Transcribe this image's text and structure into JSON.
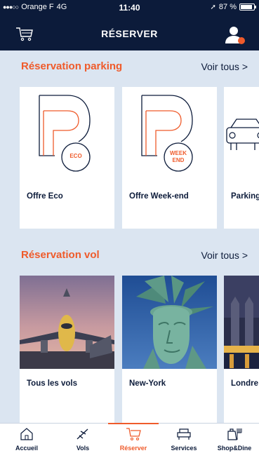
{
  "status_bar": {
    "carrier": "Orange F",
    "network": "4G",
    "time": "11:40",
    "battery": "87 %"
  },
  "header": {
    "title": "RÉSERVER"
  },
  "parking": {
    "title": "Réservation parking",
    "see_all": "Voir tous >",
    "cards": [
      {
        "label": "Offre Eco",
        "badge": "ECO"
      },
      {
        "label": "Offre Week-end",
        "badge_line1": "WEEK",
        "badge_line2": "END"
      },
      {
        "label": "Parking"
      }
    ]
  },
  "vol": {
    "title": "Réservation vol",
    "see_all": "Voir tous >",
    "cards": [
      {
        "label": "Tous les vols"
      },
      {
        "label": "New-York"
      },
      {
        "label": "Londre"
      }
    ]
  },
  "tabs": [
    {
      "label": "Accueil",
      "icon": "home-icon"
    },
    {
      "label": "Vols",
      "icon": "plane-icon"
    },
    {
      "label": "Réserver",
      "icon": "cart-icon",
      "active": true
    },
    {
      "label": "Services",
      "icon": "armchair-icon"
    },
    {
      "label": "Shop&Dine",
      "icon": "shop-icon"
    }
  ],
  "colors": {
    "navy": "#0c1b3a",
    "accent": "#ef5b2b",
    "background": "#dbe5f1"
  }
}
